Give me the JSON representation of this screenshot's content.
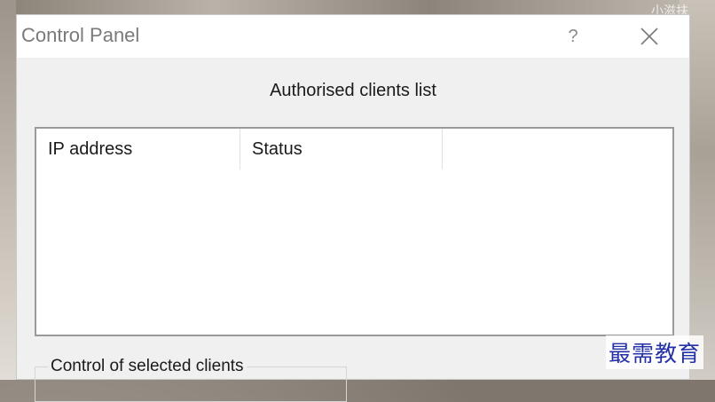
{
  "window": {
    "title": "Control Panel",
    "help_label": "?",
    "close_icon": "close-icon"
  },
  "main": {
    "section_title": "Authorised clients list",
    "list": {
      "columns": [
        "IP address",
        "Status",
        ""
      ],
      "rows": []
    },
    "group": {
      "label": "Control of selected clients"
    }
  },
  "overlay": {
    "watermark_top": "小滋扶",
    "watermark_bottom": "最需教育"
  },
  "colors": {
    "dialog_bg": "#f0f0f0",
    "titlebar_bg": "#ffffff",
    "watermark": "#2330a8"
  }
}
